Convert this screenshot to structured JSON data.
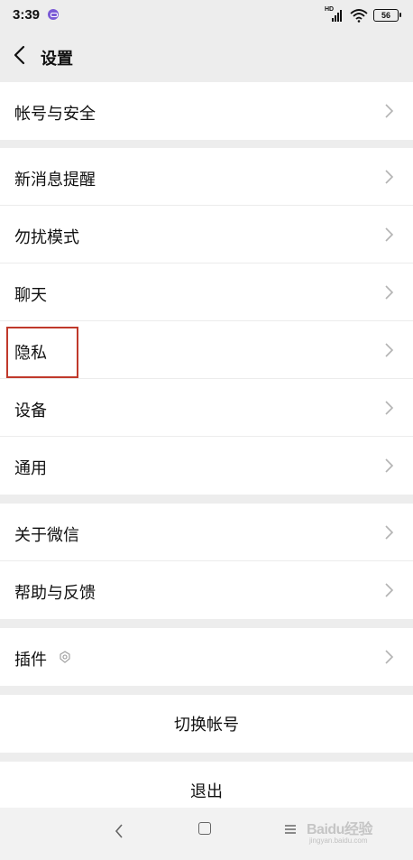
{
  "status_bar": {
    "time": "3:39",
    "signal_label": "HD",
    "battery": "56"
  },
  "header": {
    "title": "设置"
  },
  "settings_groups": [
    {
      "items": [
        {
          "label": "帐号与安全"
        }
      ]
    },
    {
      "items": [
        {
          "label": "新消息提醒"
        },
        {
          "label": "勿扰模式"
        },
        {
          "label": "聊天"
        },
        {
          "label": "隐私"
        },
        {
          "label": "设备"
        },
        {
          "label": "通用"
        }
      ]
    },
    {
      "items": [
        {
          "label": "关于微信"
        },
        {
          "label": "帮助与反馈"
        }
      ]
    },
    {
      "items": [
        {
          "label": "插件"
        }
      ]
    }
  ],
  "actions": {
    "switch_account": "切换帐号",
    "logout": "退出"
  },
  "watermark": {
    "brand": "Baidu经验",
    "url": "jingyan.baidu.com"
  },
  "colors": {
    "background": "#ededed",
    "card": "#ffffff",
    "highlight": "#c0392b",
    "app_dot": "#7b5bd6"
  }
}
